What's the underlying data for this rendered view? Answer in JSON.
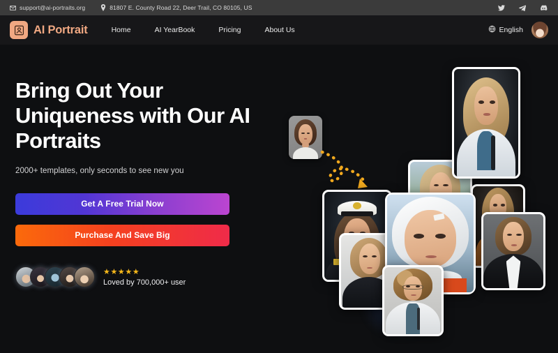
{
  "topbar": {
    "email": "support@ai-portraits.org",
    "address": "81807 E. County Road 22, Deer Trail, CO 80105, US",
    "socials": [
      {
        "name": "twitter-icon",
        "label": "Twitter"
      },
      {
        "name": "telegram-icon",
        "label": "Telegram"
      },
      {
        "name": "discord-icon",
        "label": "Discord"
      }
    ]
  },
  "navbar": {
    "brand": "AI Portrait",
    "logo_icon": "user-avatar-icon",
    "links": [
      {
        "label": "Home"
      },
      {
        "label": "AI YearBook"
      },
      {
        "label": "Pricing"
      },
      {
        "label": "About Us"
      }
    ],
    "language": "English",
    "language_icon": "globe-icon",
    "avatar_icon": "user-avatar"
  },
  "hero": {
    "headline": "Bring Out Your Uniqueness with Our AI Portraits",
    "subline": "2000+ templates, only seconds to see new you",
    "cta_primary": "Get A Free Trial Now",
    "cta_secondary": "Purchase And Save Big",
    "stars": "★★★★★",
    "rating_count": 5,
    "loved_text": "Loved by 700,000+ user",
    "avatar_count": 5
  },
  "collage": {
    "source_label": "source-photo-thumbnail",
    "arrow_label": "dotted-curved-arrow",
    "cards": [
      {
        "id": "card-sea-captain",
        "alt": "Woman in naval captain hat portrait"
      },
      {
        "id": "card-outdoor",
        "alt": "Woman outdoors windswept hair portrait"
      },
      {
        "id": "card-blonde-doctor",
        "alt": "Blonde woman doctor with stethoscope"
      },
      {
        "id": "card-police",
        "alt": "Woman in dark uniform portrait"
      },
      {
        "id": "card-astronaut",
        "alt": "Woman in astronaut helmet portrait"
      },
      {
        "id": "card-guitar",
        "alt": "Woman with guitar portrait"
      },
      {
        "id": "card-business",
        "alt": "Woman in business suit portrait"
      },
      {
        "id": "card-curly-doctor",
        "alt": "Curly haired woman doctor with glasses"
      }
    ]
  },
  "colors": {
    "background": "#0e0f11",
    "topbar": "#3b3b3b",
    "navbar": "#171719",
    "brand_accent": "#f0a882",
    "cta_primary_from": "#3b3bdb",
    "cta_primary_to": "#bb45d0",
    "cta_secondary_from": "#fb6a0b",
    "cta_secondary_to": "#ef2b49",
    "star": "#f5b81b",
    "arrow": "#f0a81e"
  }
}
